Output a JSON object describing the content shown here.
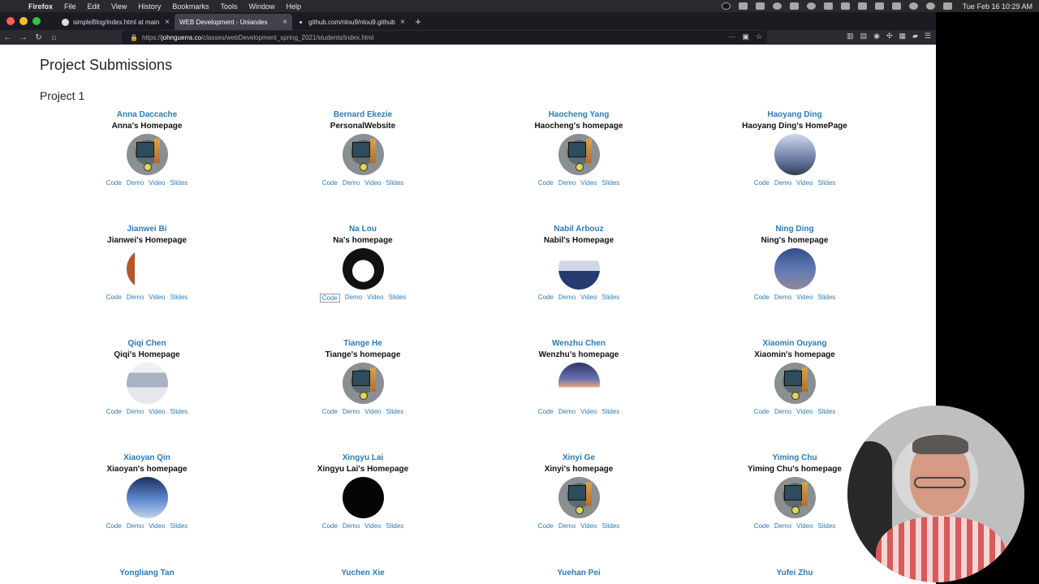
{
  "menubar": {
    "app": "Firefox",
    "menus": [
      "File",
      "Edit",
      "View",
      "History",
      "Bookmarks",
      "Tools",
      "Window",
      "Help"
    ],
    "clock": "Tue Feb 16  10:29 AM"
  },
  "browser": {
    "tabs": [
      {
        "label": "simpleBlog/index.html at main"
      },
      {
        "label": "WEB Development - Uniandes"
      },
      {
        "label": "github.com/nlou9/nlou9.github"
      }
    ],
    "new_tab": "+",
    "url_prefix": "https://",
    "url_host": "johnguerra.co",
    "url_path": "/classes/webDevelopment_spring_2021/students/index.html"
  },
  "page": {
    "title": "Project Submissions",
    "section": "Project 1",
    "link_labels": [
      "Code",
      "Demo",
      "Video",
      "Slides"
    ],
    "students": [
      {
        "name": "Anna Daccache",
        "project": "Anna's Homepage",
        "thumb": "default"
      },
      {
        "name": "Bernard Ekezie",
        "project": "PersonalWebsite",
        "thumb": "default"
      },
      {
        "name": "Haocheng Yang",
        "project": "Haocheng's homepage",
        "thumb": "default"
      },
      {
        "name": "Haoyang Ding",
        "project": "Haoyang Ding's HomePage",
        "thumb": "sky"
      },
      {
        "name": "Jianwei Bi",
        "project": "Jianwei's Homepage",
        "thumb": "nav"
      },
      {
        "name": "Na Lou",
        "project": "Na's homepage",
        "thumb": "dark"
      },
      {
        "name": "Nabil Arbouz",
        "project": "Nabil's Homepage",
        "thumb": "web"
      },
      {
        "name": "Ning Ding",
        "project": "Ning's homepage",
        "thumb": "lake"
      },
      {
        "name": "Qiqi Chen",
        "project": "Qiqi's Homepage",
        "thumb": "mountain"
      },
      {
        "name": "Tiange He",
        "project": "Tiange's homepage",
        "thumb": "default"
      },
      {
        "name": "Wenzhu Chen",
        "project": "Wenzhu's homepage",
        "thumb": "sunset"
      },
      {
        "name": "Xiaomin Ouyang",
        "project": "Xiaomin's homepage",
        "thumb": "default"
      },
      {
        "name": "Xiaoyan Qin",
        "project": "Xiaoyan's homepage",
        "thumb": "cloud"
      },
      {
        "name": "Xingyu Lai",
        "project": "Xingyu Lai's Homepage",
        "thumb": "black"
      },
      {
        "name": "Xinyi Ge",
        "project": "Xinyi's homepage",
        "thumb": "default"
      },
      {
        "name": "Yiming Chu",
        "project": "Yiming Chu's homepage",
        "thumb": "default"
      }
    ],
    "next_row": [
      "Yongliang Tan",
      "Yuchen Xie",
      "Yuehan Pei",
      "Yufei Zhu"
    ]
  }
}
